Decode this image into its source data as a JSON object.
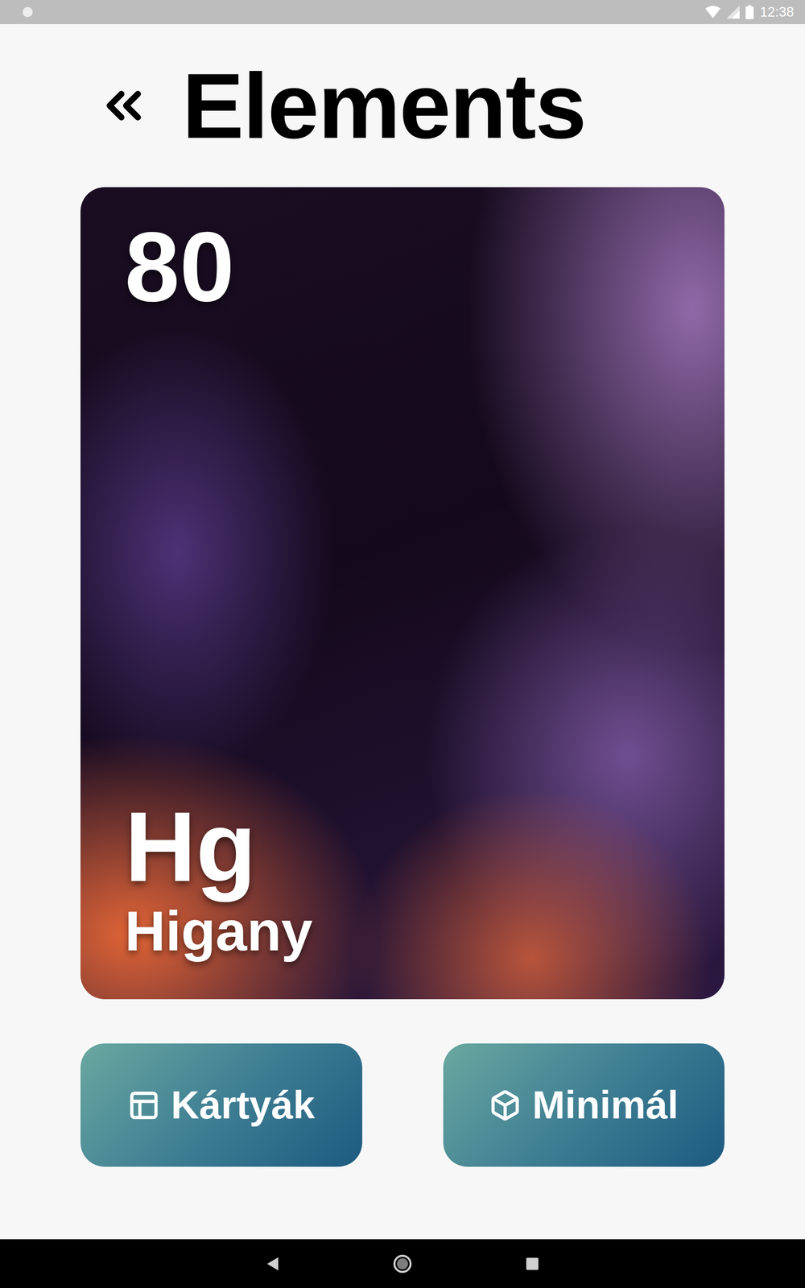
{
  "status_bar": {
    "time": "12:38"
  },
  "header": {
    "title": "Elements"
  },
  "element": {
    "number": "80",
    "symbol": "Hg",
    "name": "Higany"
  },
  "buttons": [
    {
      "label": "Kártyák"
    },
    {
      "label": "Minimál"
    }
  ]
}
